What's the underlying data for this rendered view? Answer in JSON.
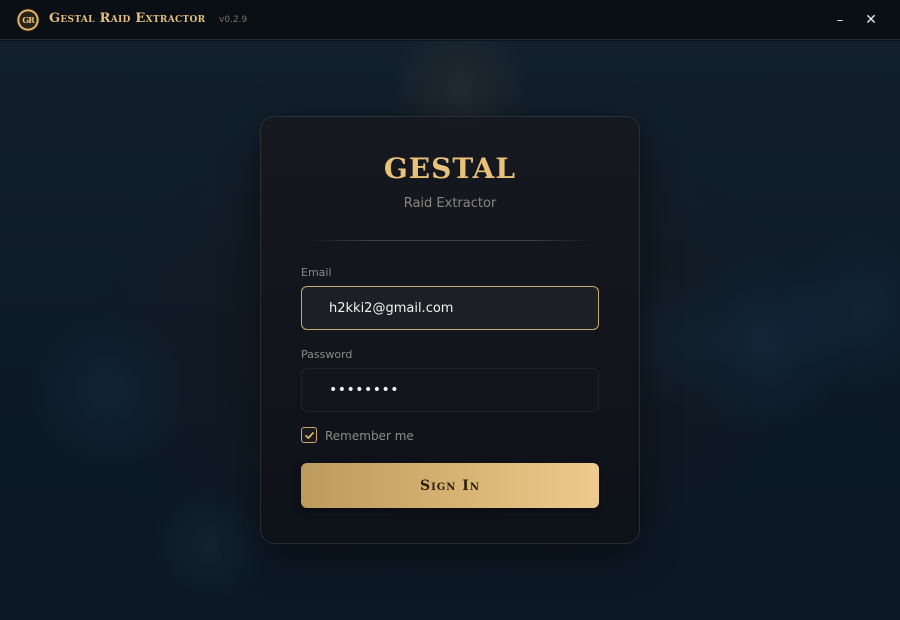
{
  "window": {
    "title": "Gestal Raid Extractor",
    "version": "v0.2.9",
    "logo_text": "GR",
    "minimize_glyph": "–",
    "close_glyph": "✕"
  },
  "login": {
    "brand": "GESTAL",
    "subtitle": "Raid Extractor",
    "email_label": "Email",
    "email_value": "h2kki2@gmail.com",
    "password_label": "Password",
    "password_mask": "••••••••",
    "remember_label": "Remember me",
    "remember_checked": true,
    "signin_label": "Sign In"
  },
  "colors": {
    "accent_gold": "#e9c27a",
    "button_gradient_start": "#bd9a5e",
    "button_gradient_end": "#eecb8e",
    "background": "#0d1a27"
  },
  "icons": [
    "app-logo-icon",
    "minimize-icon",
    "close-icon",
    "checkmark-icon"
  ]
}
